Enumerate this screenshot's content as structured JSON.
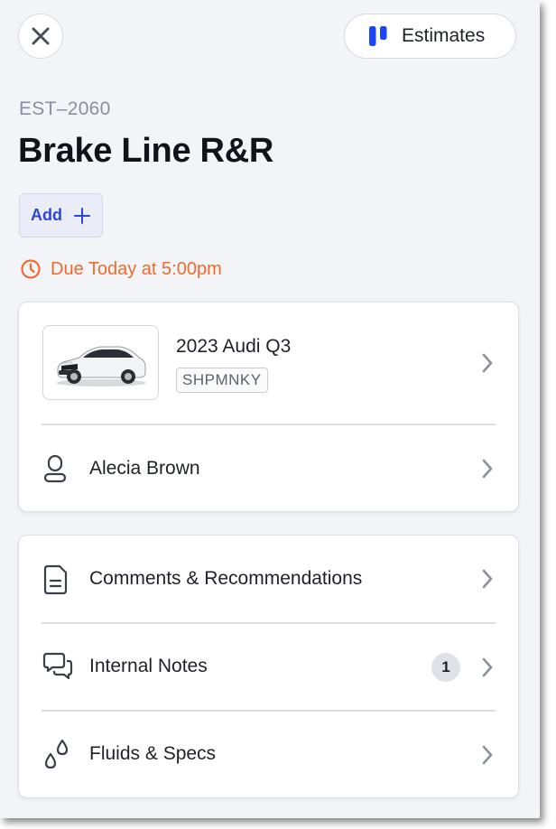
{
  "header": {
    "close_icon": "close-icon",
    "estimates_label": "Estimates",
    "estimates_icon": "board-columns-icon",
    "accent": "#1c46f5"
  },
  "estimate": {
    "id": "EST–2060",
    "title": "Brake Line R&R",
    "add_label": "Add",
    "due_text": "Due Today at 5:00pm",
    "due_color": "#f06a2c"
  },
  "vehicle_card": {
    "vehicle_name": "2023 Audi Q3",
    "plate": "SHPMNKY",
    "customer_name": "Alecia Brown"
  },
  "sections": [
    {
      "label": "Comments & Recommendations",
      "icon": "document-icon",
      "badge": null
    },
    {
      "label": "Internal Notes",
      "icon": "chat-bubbles-icon",
      "badge": "1"
    },
    {
      "label": "Fluids & Specs",
      "icon": "droplets-icon",
      "badge": null
    }
  ]
}
